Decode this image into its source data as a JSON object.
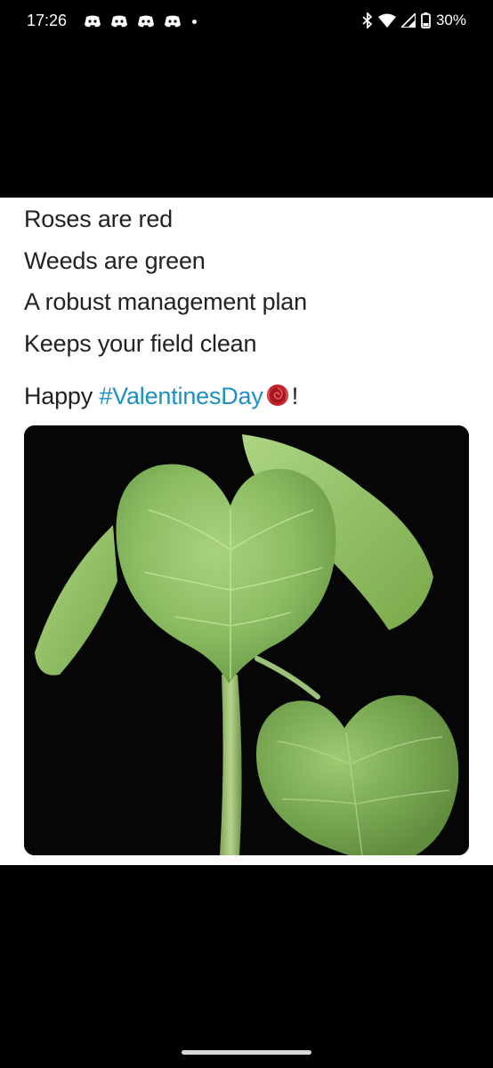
{
  "status_bar": {
    "time": "17:26",
    "notification_icons": [
      "discord-icon",
      "discord-icon",
      "discord-icon",
      "discord-icon"
    ],
    "more_notifications": "dot-icon",
    "system_icons": [
      "bluetooth-icon",
      "wifi-icon",
      "signal-icon",
      "battery-icon"
    ],
    "battery_percent": "30%"
  },
  "post": {
    "lines": [
      "Roses are red",
      "Weeds are green",
      "A robust management plan",
      "Keeps your field clean"
    ],
    "closing_prefix": "Happy ",
    "hashtag": "#ValentinesDay",
    "emoji": "rose-icon",
    "closing_suffix": "!",
    "image": "photo of a green seedling with heart-shaped leaves on a black background"
  },
  "colors": {
    "background": "#000000",
    "card": "#ffffff",
    "text": "#222222",
    "hashtag": "#1d8fc4"
  }
}
